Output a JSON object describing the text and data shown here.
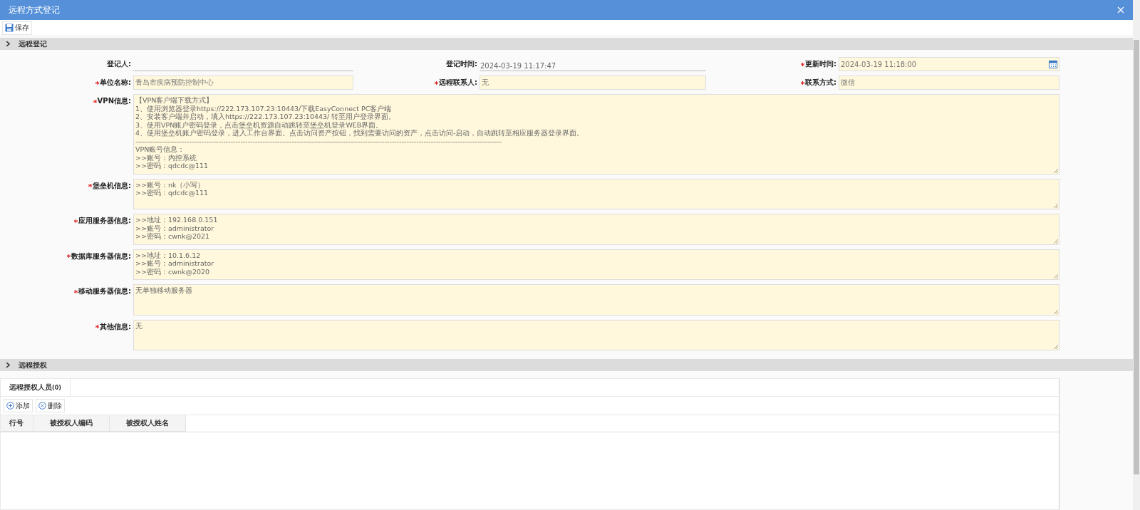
{
  "window": {
    "title": "远程方式登记"
  },
  "toolbar": {
    "buttons": [
      "保存"
    ]
  },
  "sections": [
    {
      "title": "远程登记",
      "expanded": false
    },
    {
      "title": "远程授权",
      "expanded": false
    }
  ],
  "form": {
    "rows": [
      [
        {
          "label": "登记人:",
          "required": false,
          "kind": "underline"
        },
        {
          "label": "登记时间:",
          "required": false,
          "kind": "underline",
          "value": "2024-03-19 11:17:47"
        },
        {
          "label": "更新时间:",
          "required": true,
          "kind": "date",
          "value": "2024-03-19 11:18:00"
        }
      ],
      [
        {
          "label": "单位名称:",
          "required": true,
          "kind": "input",
          "value": "青岛市疾病预防控制中心"
        },
        {
          "label": "远程联系人:",
          "required": true,
          "kind": "input",
          "value": "无"
        },
        {
          "label": "联系方式:",
          "required": true,
          "kind": "input",
          "value": "微信"
        }
      ]
    ],
    "textareas": [
      {
        "label": "VPN信息:",
        "required": true,
        "value": "【VPN客户端下载方式】\n1、使用浏览器登录https://222.173.107.23:10443/下载EasyConnect PC客户端\n2、安装客户端并启动，填入https://222.173.107.23:10443/ 转至用户登录界面。\n3、使用VPN账户密码登录，点击堡垒机资源自动跳转至堡垒机登录WEB界面。\n4、使用堡垒机账户密码登录，进入工作台界面。点击访问资产按钮，找到需要访问的资产，点击访问-启动，自动跳转至相应服务器登录界面。\n------------------------------------------------------------------------------------------------------------------------------------------------------\nVPN账号信息：\n>>账号：内控系统\n>>密码：qdcdc@111"
      },
      {
        "label": "堡垒机信息:",
        "required": true,
        "value": ">>账号：nk（小写）\n>>密码：qdcdc@111"
      },
      {
        "label": "应用服务器信息:",
        "required": true,
        "value": ">>地址：192.168.0.151\n>>账号：administrator\n>>密码：cwnk@2021"
      },
      {
        "label": "数据库服务器信息:",
        "required": true,
        "value": ">>地址：10.1.6.12\n>>账号：administrator\n>>密码：cwnk@2020"
      },
      {
        "label": "移动服务器信息:",
        "required": true,
        "value": "无单独移动服务器"
      },
      {
        "label": "其他信息:",
        "required": true,
        "value": "无"
      }
    ]
  },
  "auth": {
    "tabs": [
      {
        "label": "远程授权人员",
        "count": "(0)",
        "selected": true
      }
    ],
    "buttons": [
      {
        "kind": "add",
        "label": "添加"
      },
      {
        "kind": "delete",
        "label": "删除"
      }
    ],
    "table": {
      "columns": [
        "行号",
        "被授权人编码",
        "被授权人姓名"
      ]
    }
  }
}
